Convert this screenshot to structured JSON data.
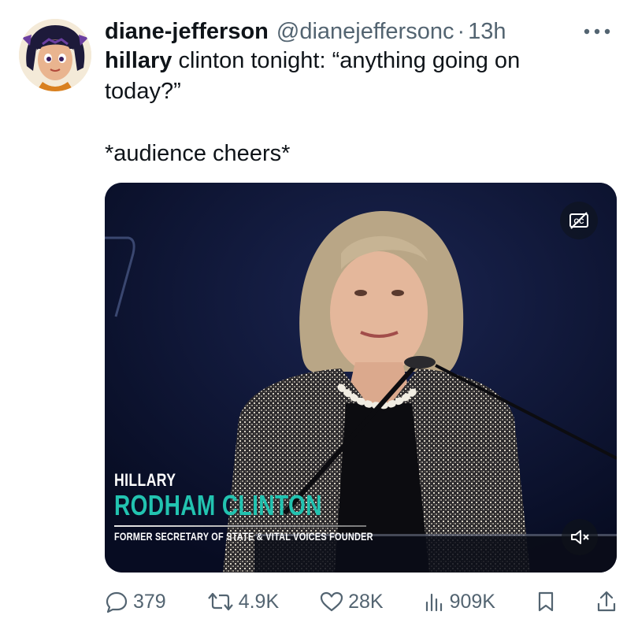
{
  "tweet": {
    "display_name": "diane-jefferson",
    "handle": "@dianejeffersonc",
    "separator": "·",
    "time": "13h",
    "more_icon": "more-horizontal-icon",
    "text": {
      "line1_bold": "hillary",
      "line1_rest": " clinton tonight: “anything going on",
      "line2": "today?”",
      "line3": "*audience cheers*"
    }
  },
  "media": {
    "lower_third": {
      "first_name": "HILLARY",
      "last_name": "RODHAM CLINTON",
      "subtitle": "FORMER SECRETARY OF STATE & VITAL VOICES FOUNDER"
    },
    "cc_icon": "closed-captions-off-icon",
    "mute_icon": "volume-muted-icon"
  },
  "actions": {
    "replies": "379",
    "reposts": "4.9K",
    "likes": "28K",
    "views": "909K"
  },
  "colors": {
    "text": "#0f1419",
    "secondary": "#536471",
    "accent_teal": "#22c3b0"
  }
}
